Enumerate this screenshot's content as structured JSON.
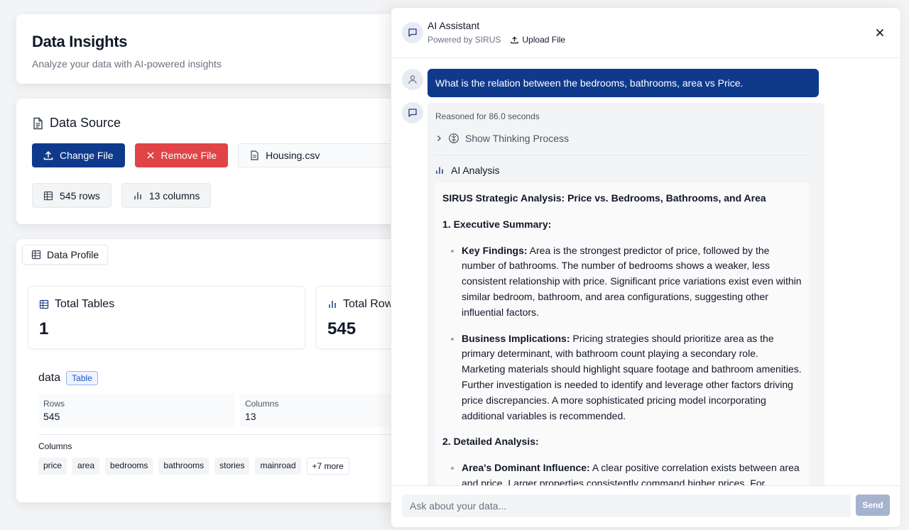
{
  "header": {
    "title": "Data Insights",
    "subtitle": "Analyze your data with AI-powered insights"
  },
  "data_source": {
    "title": "Data Source",
    "change_file_label": "Change File",
    "remove_file_label": "Remove File",
    "file_name": "Housing.csv",
    "rows_label": "545 rows",
    "columns_label": "13 columns"
  },
  "profile": {
    "tab_label": "Data Profile",
    "metrics": [
      {
        "label": "Total Tables",
        "value": "1"
      },
      {
        "label": "Total Rows",
        "value": "545"
      }
    ],
    "table": {
      "name": "data",
      "badge": "Table",
      "rows_key": "Rows",
      "rows_value": "545",
      "columns_key": "Columns",
      "columns_value": "13",
      "columns_label": "Columns",
      "chips": [
        "price",
        "area",
        "bedrooms",
        "bathrooms",
        "stories",
        "mainroad",
        "+7 more"
      ]
    }
  },
  "assistant": {
    "title": "AI Assistant",
    "powered_by": "Powered by SIRUS",
    "upload_label": "Upload File",
    "user_message": "What is the relation between the bedrooms, bathrooms, area vs Price.",
    "reasoned": "Reasoned for 86.0 seconds",
    "thinking_label": "Show Thinking Process",
    "analysis_label": "AI Analysis",
    "report": {
      "title": "SIRUS Strategic Analysis: Price vs. Bedrooms, Bathrooms, and Area",
      "section1": "1. Executive Summary:",
      "kf_label": "Key Findings:",
      "kf_text": " Area is the strongest predictor of price, followed by the number of bathrooms. The number of bedrooms shows a weaker, less consistent relationship with price. Significant price variations exist even within similar bedroom, bathroom, and area configurations, suggesting other influential factors.",
      "bi_label": "Business Implications:",
      "bi_text": " Pricing strategies should prioritize area as the primary determinant, with bathroom count playing a secondary role. Marketing materials should highlight square footage and bathroom amenities. Further investigation is needed to identify and leverage other factors driving price discrepancies. A more sophisticated pricing model incorporating additional variables is recommended.",
      "section2": "2. Detailed Analysis:",
      "ad_label": "Area's Dominant Influence:",
      "ad_text": " A clear positive correlation exists between area and price. Larger properties consistently command higher prices. For example,"
    },
    "input_placeholder": "Ask about your data...",
    "send_label": "Send"
  }
}
